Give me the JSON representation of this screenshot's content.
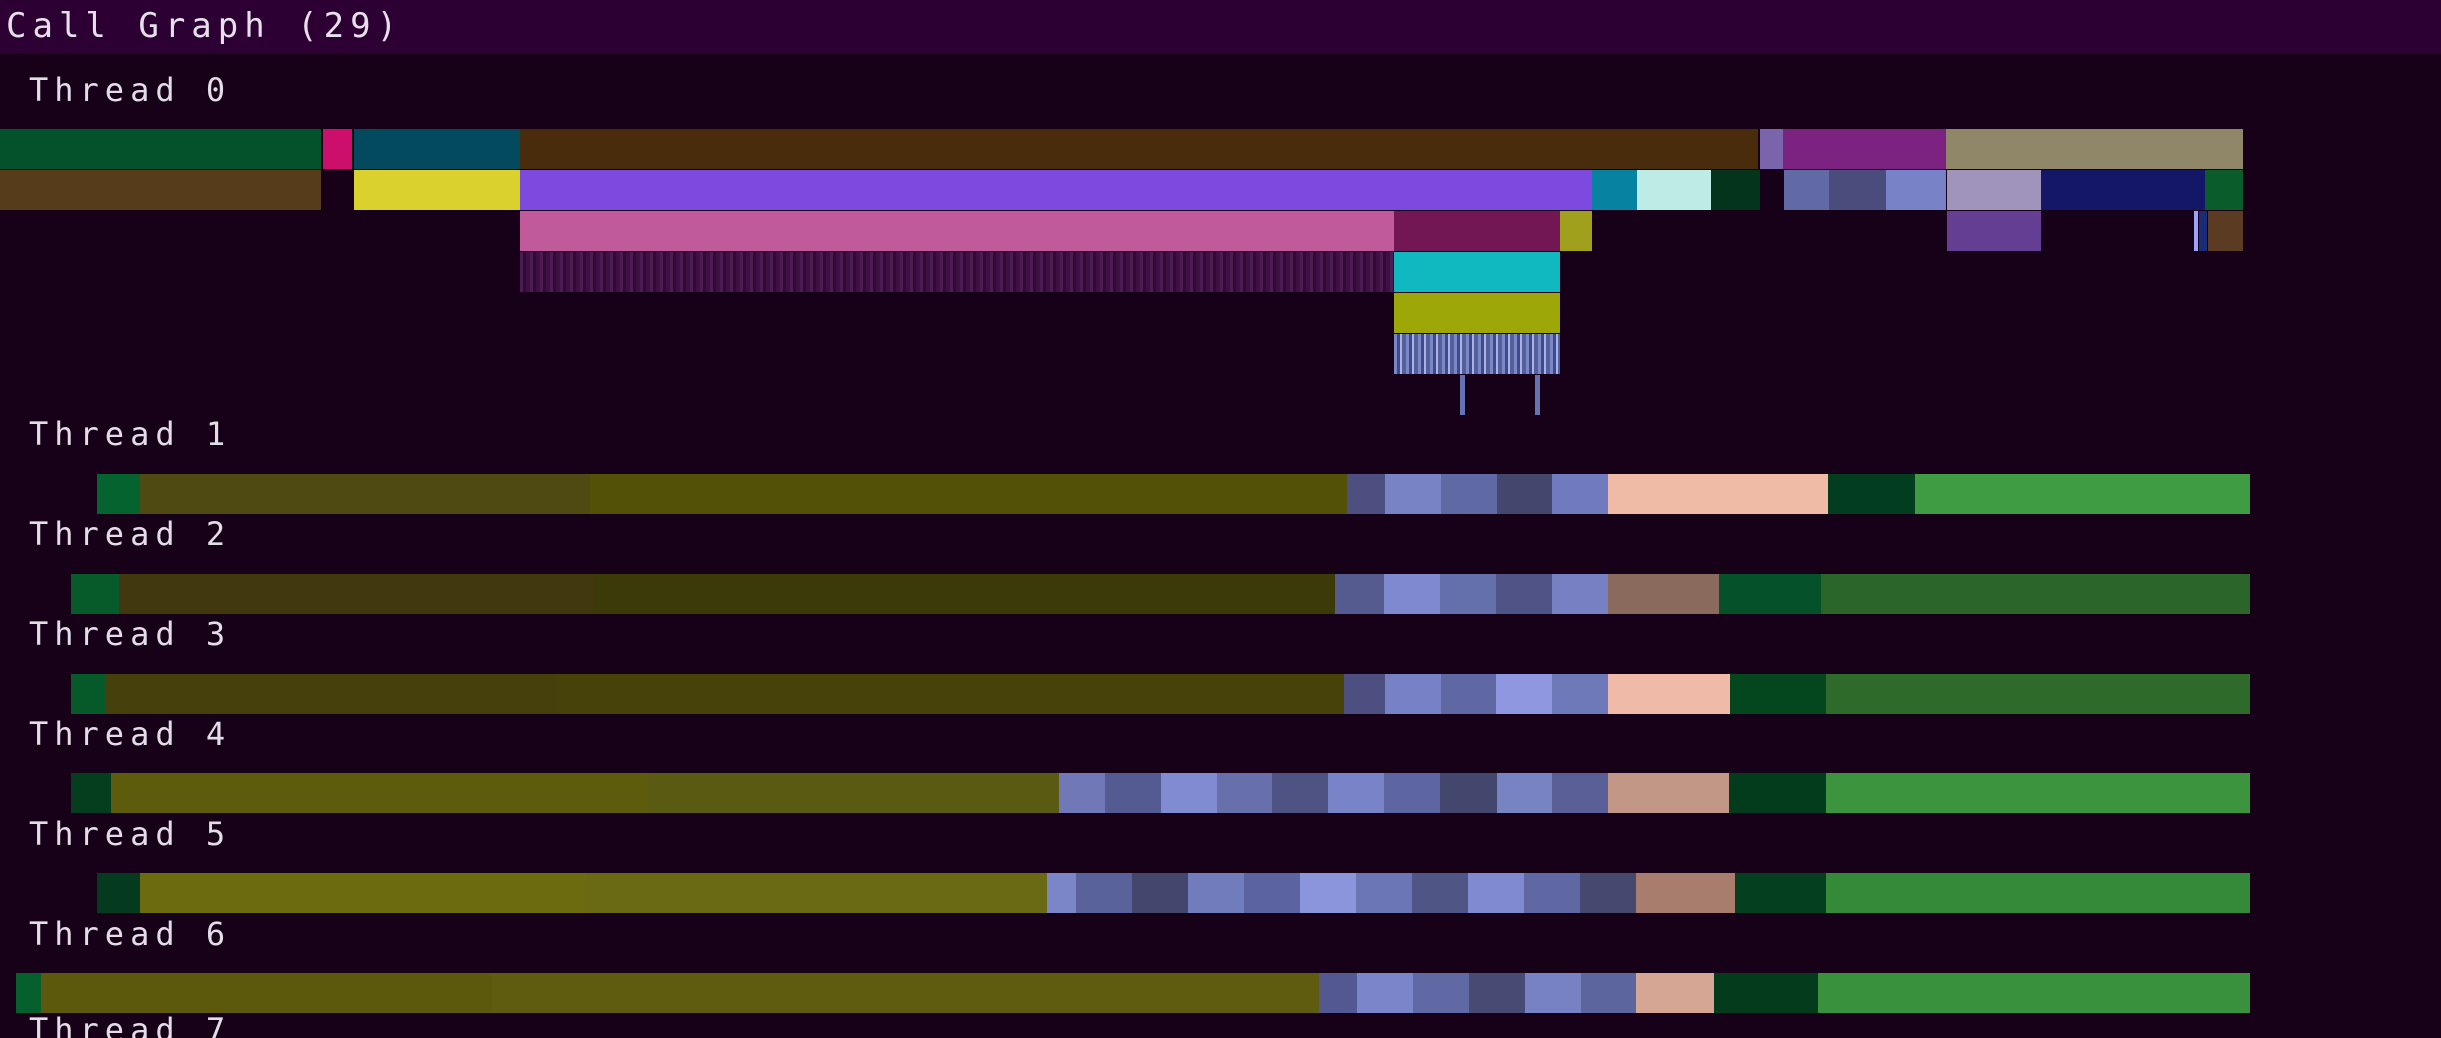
{
  "window": {
    "title": "Call Graph (29)"
  },
  "threads": [
    {
      "label": "Thread 0"
    },
    {
      "label": "Thread 1"
    },
    {
      "label": "Thread 2"
    },
    {
      "label": "Thread 3"
    },
    {
      "label": "Thread 4"
    },
    {
      "label": "Thread 5"
    },
    {
      "label": "Thread 6"
    },
    {
      "label": "Thread 7"
    }
  ],
  "colors": {
    "background": "#170119",
    "titlebar": "#2d0033"
  }
}
